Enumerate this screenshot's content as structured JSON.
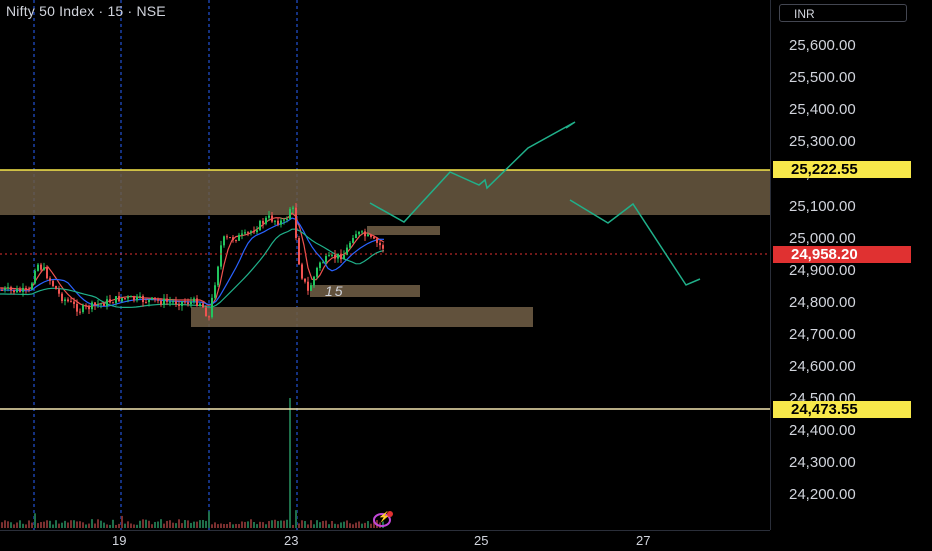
{
  "header": {
    "symbol_title": "Nifty 50 Index · 15 · NSE",
    "currency_label": "INR"
  },
  "price_axis": {
    "ticks": [
      "25,600.00",
      "25,500.00",
      "25,400.00",
      "25,300.00",
      "25,200.00",
      "25,100.00",
      "25,000.00",
      "24,900.00",
      "24,800.00",
      "24,700.00",
      "24,600.00",
      "24,500.00",
      "24,400.00",
      "24,300.00",
      "24,200.00"
    ],
    "resistance_badge": "25,222.55",
    "current_price_badge": "24,958.20",
    "support_badge": "24,473.55"
  },
  "time_axis": {
    "labels": [
      "19",
      "23",
      "25",
      "27"
    ]
  },
  "annotations": {
    "zone_label": "15"
  },
  "colors": {
    "accent_yellow": "#f7e84a",
    "price_red": "#e03131",
    "zone_fill": "#6b5a42",
    "projection_line": "#20b08a",
    "candle_up": "#22c55e",
    "candle_down": "#ef5350",
    "session_divider": "#2962ff"
  },
  "icons": {
    "replay": "lightning-circle-icon"
  }
}
